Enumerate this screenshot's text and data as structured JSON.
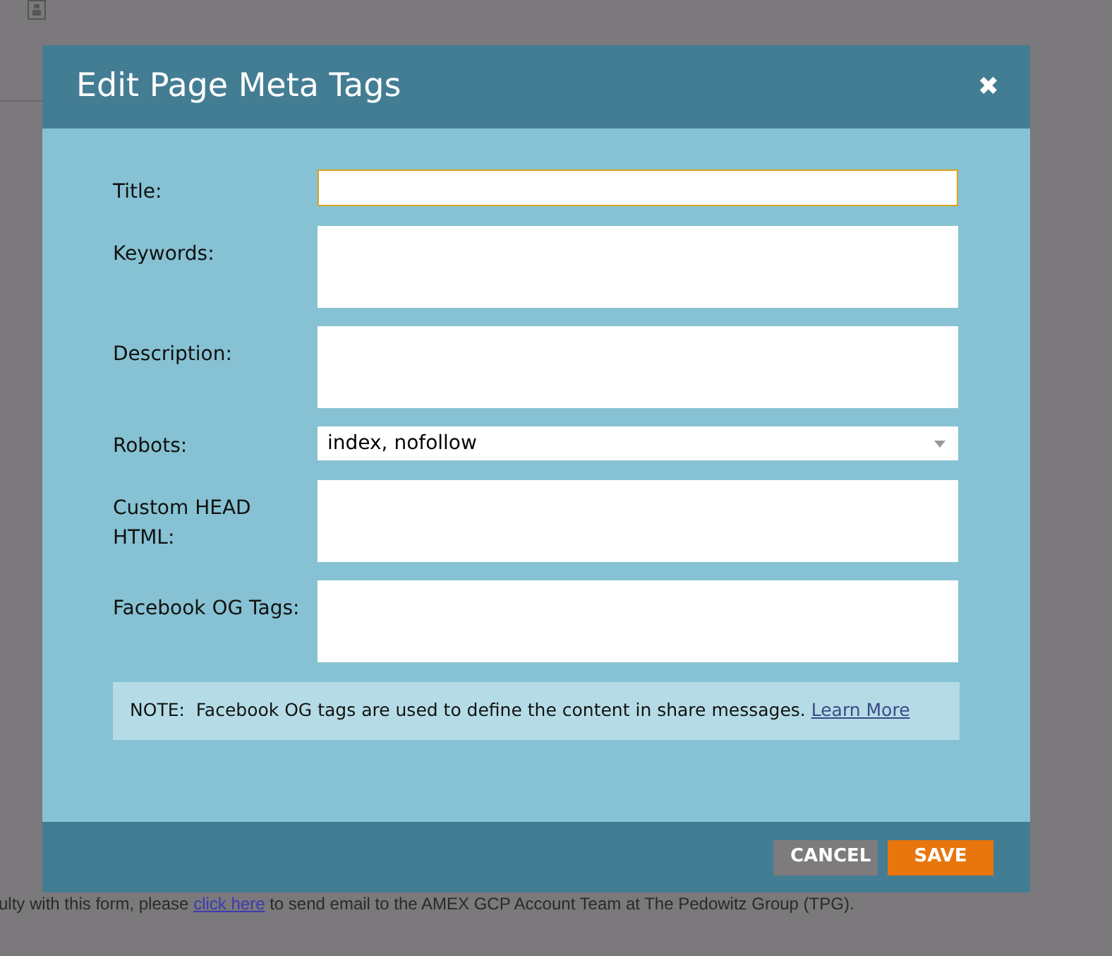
{
  "background": {
    "footer_text_before": "ulty with this form, please",
    "footer_link": "click here",
    "footer_text_after": "to send email to the AMEX GCP Account Team at The Pedowitz Group (TPG)."
  },
  "dialog": {
    "title": "Edit Page Meta Tags",
    "close": "✖",
    "fields": [
      {
        "label": "Title:",
        "kind": "text",
        "focused": true
      },
      {
        "label": "Keywords:",
        "kind": "textarea",
        "focused": false
      },
      {
        "label": "Description:",
        "kind": "textarea",
        "focused": false
      },
      {
        "label": "Robots:",
        "kind": "select",
        "value": "index, nofollow",
        "focused": false
      },
      {
        "label": "Custom HEAD HTML:",
        "kind": "textarea",
        "focused": false
      },
      {
        "label": "Facebook OG Tags:",
        "kind": "textarea",
        "focused": false
      }
    ],
    "note": {
      "text": "NOTE:  Facebook OG tags are used to define the content in share messages.",
      "link": "Learn More"
    },
    "buttons": [
      {
        "label": "CANCEL",
        "kind": "secondary"
      },
      {
        "label": "SAVE",
        "kind": "primary"
      }
    ]
  }
}
